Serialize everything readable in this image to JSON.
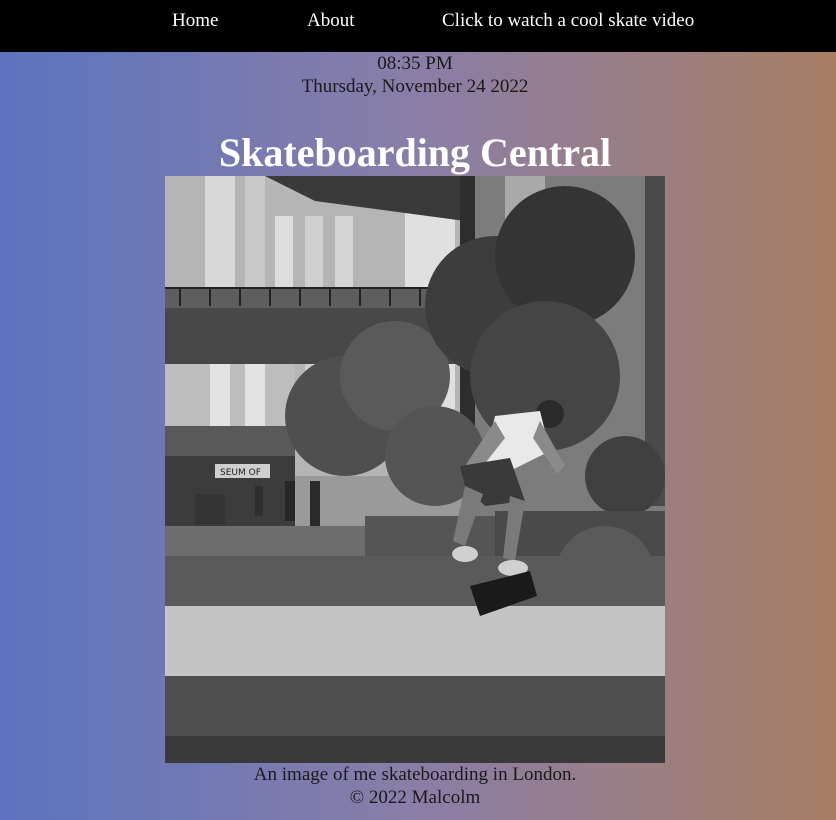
{
  "nav": {
    "home": "Home",
    "about": "About",
    "video": "Click to watch a cool skate video"
  },
  "clock": {
    "time": "08:35 PM",
    "date": "Thursday, November 24 2022"
  },
  "page_title": "Skateboarding Central",
  "photo": {
    "alt": "An image of me skateboarding in London.",
    "sign_text": "SEUM OF"
  },
  "caption": "An image of me skateboarding in London.",
  "footer": "© 2022 Malcolm",
  "colors": {
    "gradient_left": "#5b74bf",
    "gradient_mid": "#8a7ea7",
    "gradient_right": "#a77e63",
    "nav_bg": "#000000",
    "nav_text": "#ffffff",
    "title_text": "#ffffff"
  }
}
